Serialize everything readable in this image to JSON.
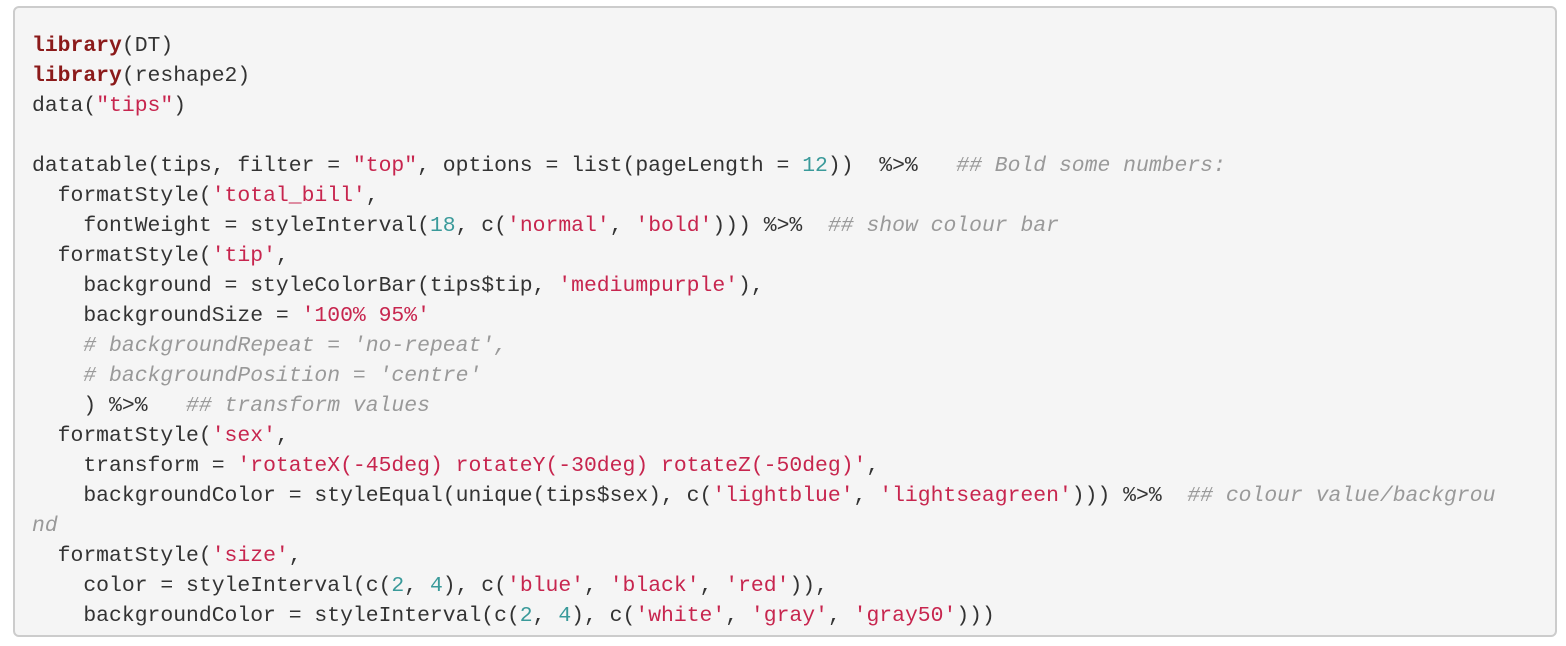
{
  "colors": {
    "background": "#f5f5f5",
    "border": "#cccccc",
    "plain": "#333333",
    "keyword": "#8b1a1a",
    "string": "#c7254e",
    "number": "#3a9a9a",
    "comment": "#999999"
  },
  "code_lines": [
    [
      {
        "t": "kw",
        "v": "library"
      },
      {
        "t": "pl",
        "v": "(DT)"
      }
    ],
    [
      {
        "t": "kw",
        "v": "library"
      },
      {
        "t": "pl",
        "v": "(reshape2)"
      }
    ],
    [
      {
        "t": "pl",
        "v": "data("
      },
      {
        "t": "str",
        "v": "\"tips\""
      },
      {
        "t": "pl",
        "v": ")"
      }
    ],
    [],
    [
      {
        "t": "pl",
        "v": "datatable(tips, filter = "
      },
      {
        "t": "str",
        "v": "\"top\""
      },
      {
        "t": "pl",
        "v": ", options = list(pageLength = "
      },
      {
        "t": "num",
        "v": "12"
      },
      {
        "t": "pl",
        "v": "))  %>%   "
      },
      {
        "t": "com",
        "v": "## Bold some numbers:"
      }
    ],
    [
      {
        "t": "pl",
        "v": "  formatStyle("
      },
      {
        "t": "str",
        "v": "'total_bill'"
      },
      {
        "t": "pl",
        "v": ","
      }
    ],
    [
      {
        "t": "pl",
        "v": "    fontWeight = styleInterval("
      },
      {
        "t": "num",
        "v": "18"
      },
      {
        "t": "pl",
        "v": ", c("
      },
      {
        "t": "str",
        "v": "'normal'"
      },
      {
        "t": "pl",
        "v": ", "
      },
      {
        "t": "str",
        "v": "'bold'"
      },
      {
        "t": "pl",
        "v": "))) %>%  "
      },
      {
        "t": "com",
        "v": "## show colour bar"
      }
    ],
    [
      {
        "t": "pl",
        "v": "  formatStyle("
      },
      {
        "t": "str",
        "v": "'tip'"
      },
      {
        "t": "pl",
        "v": ","
      }
    ],
    [
      {
        "t": "pl",
        "v": "    background = styleColorBar(tips$tip, "
      },
      {
        "t": "str",
        "v": "'mediumpurple'"
      },
      {
        "t": "pl",
        "v": "),"
      }
    ],
    [
      {
        "t": "pl",
        "v": "    backgroundSize = "
      },
      {
        "t": "str",
        "v": "'100% 95%'"
      }
    ],
    [
      {
        "t": "pl",
        "v": "    "
      },
      {
        "t": "com",
        "v": "# backgroundRepeat = 'no-repeat',"
      }
    ],
    [
      {
        "t": "pl",
        "v": "    "
      },
      {
        "t": "com",
        "v": "# backgroundPosition = 'centre'"
      }
    ],
    [
      {
        "t": "pl",
        "v": "    ) %>%   "
      },
      {
        "t": "com",
        "v": "## transform values"
      }
    ],
    [
      {
        "t": "pl",
        "v": "  formatStyle("
      },
      {
        "t": "str",
        "v": "'sex'"
      },
      {
        "t": "pl",
        "v": ","
      }
    ],
    [
      {
        "t": "pl",
        "v": "    transform = "
      },
      {
        "t": "str",
        "v": "'rotateX(-45deg) rotateY(-30deg) rotateZ(-50deg)'"
      },
      {
        "t": "pl",
        "v": ","
      }
    ],
    [
      {
        "t": "pl",
        "v": "    backgroundColor = styleEqual(unique(tips$sex), c("
      },
      {
        "t": "str",
        "v": "'lightblue'"
      },
      {
        "t": "pl",
        "v": ", "
      },
      {
        "t": "str",
        "v": "'lightseagreen'"
      },
      {
        "t": "pl",
        "v": "))) %>%  "
      },
      {
        "t": "com",
        "v": "## colour value/backgrou"
      }
    ],
    [
      {
        "t": "com",
        "v": "nd"
      }
    ],
    [
      {
        "t": "pl",
        "v": "  formatStyle("
      },
      {
        "t": "str",
        "v": "'size'"
      },
      {
        "t": "pl",
        "v": ","
      }
    ],
    [
      {
        "t": "pl",
        "v": "    color = styleInterval(c("
      },
      {
        "t": "num",
        "v": "2"
      },
      {
        "t": "pl",
        "v": ", "
      },
      {
        "t": "num",
        "v": "4"
      },
      {
        "t": "pl",
        "v": "), c("
      },
      {
        "t": "str",
        "v": "'blue'"
      },
      {
        "t": "pl",
        "v": ", "
      },
      {
        "t": "str",
        "v": "'black'"
      },
      {
        "t": "pl",
        "v": ", "
      },
      {
        "t": "str",
        "v": "'red'"
      },
      {
        "t": "pl",
        "v": ")),"
      }
    ],
    [
      {
        "t": "pl",
        "v": "    backgroundColor = styleInterval(c("
      },
      {
        "t": "num",
        "v": "2"
      },
      {
        "t": "pl",
        "v": ", "
      },
      {
        "t": "num",
        "v": "4"
      },
      {
        "t": "pl",
        "v": "), c("
      },
      {
        "t": "str",
        "v": "'white'"
      },
      {
        "t": "pl",
        "v": ", "
      },
      {
        "t": "str",
        "v": "'gray'"
      },
      {
        "t": "pl",
        "v": ", "
      },
      {
        "t": "str",
        "v": "'gray50'"
      },
      {
        "t": "pl",
        "v": ")))"
      }
    ]
  ]
}
